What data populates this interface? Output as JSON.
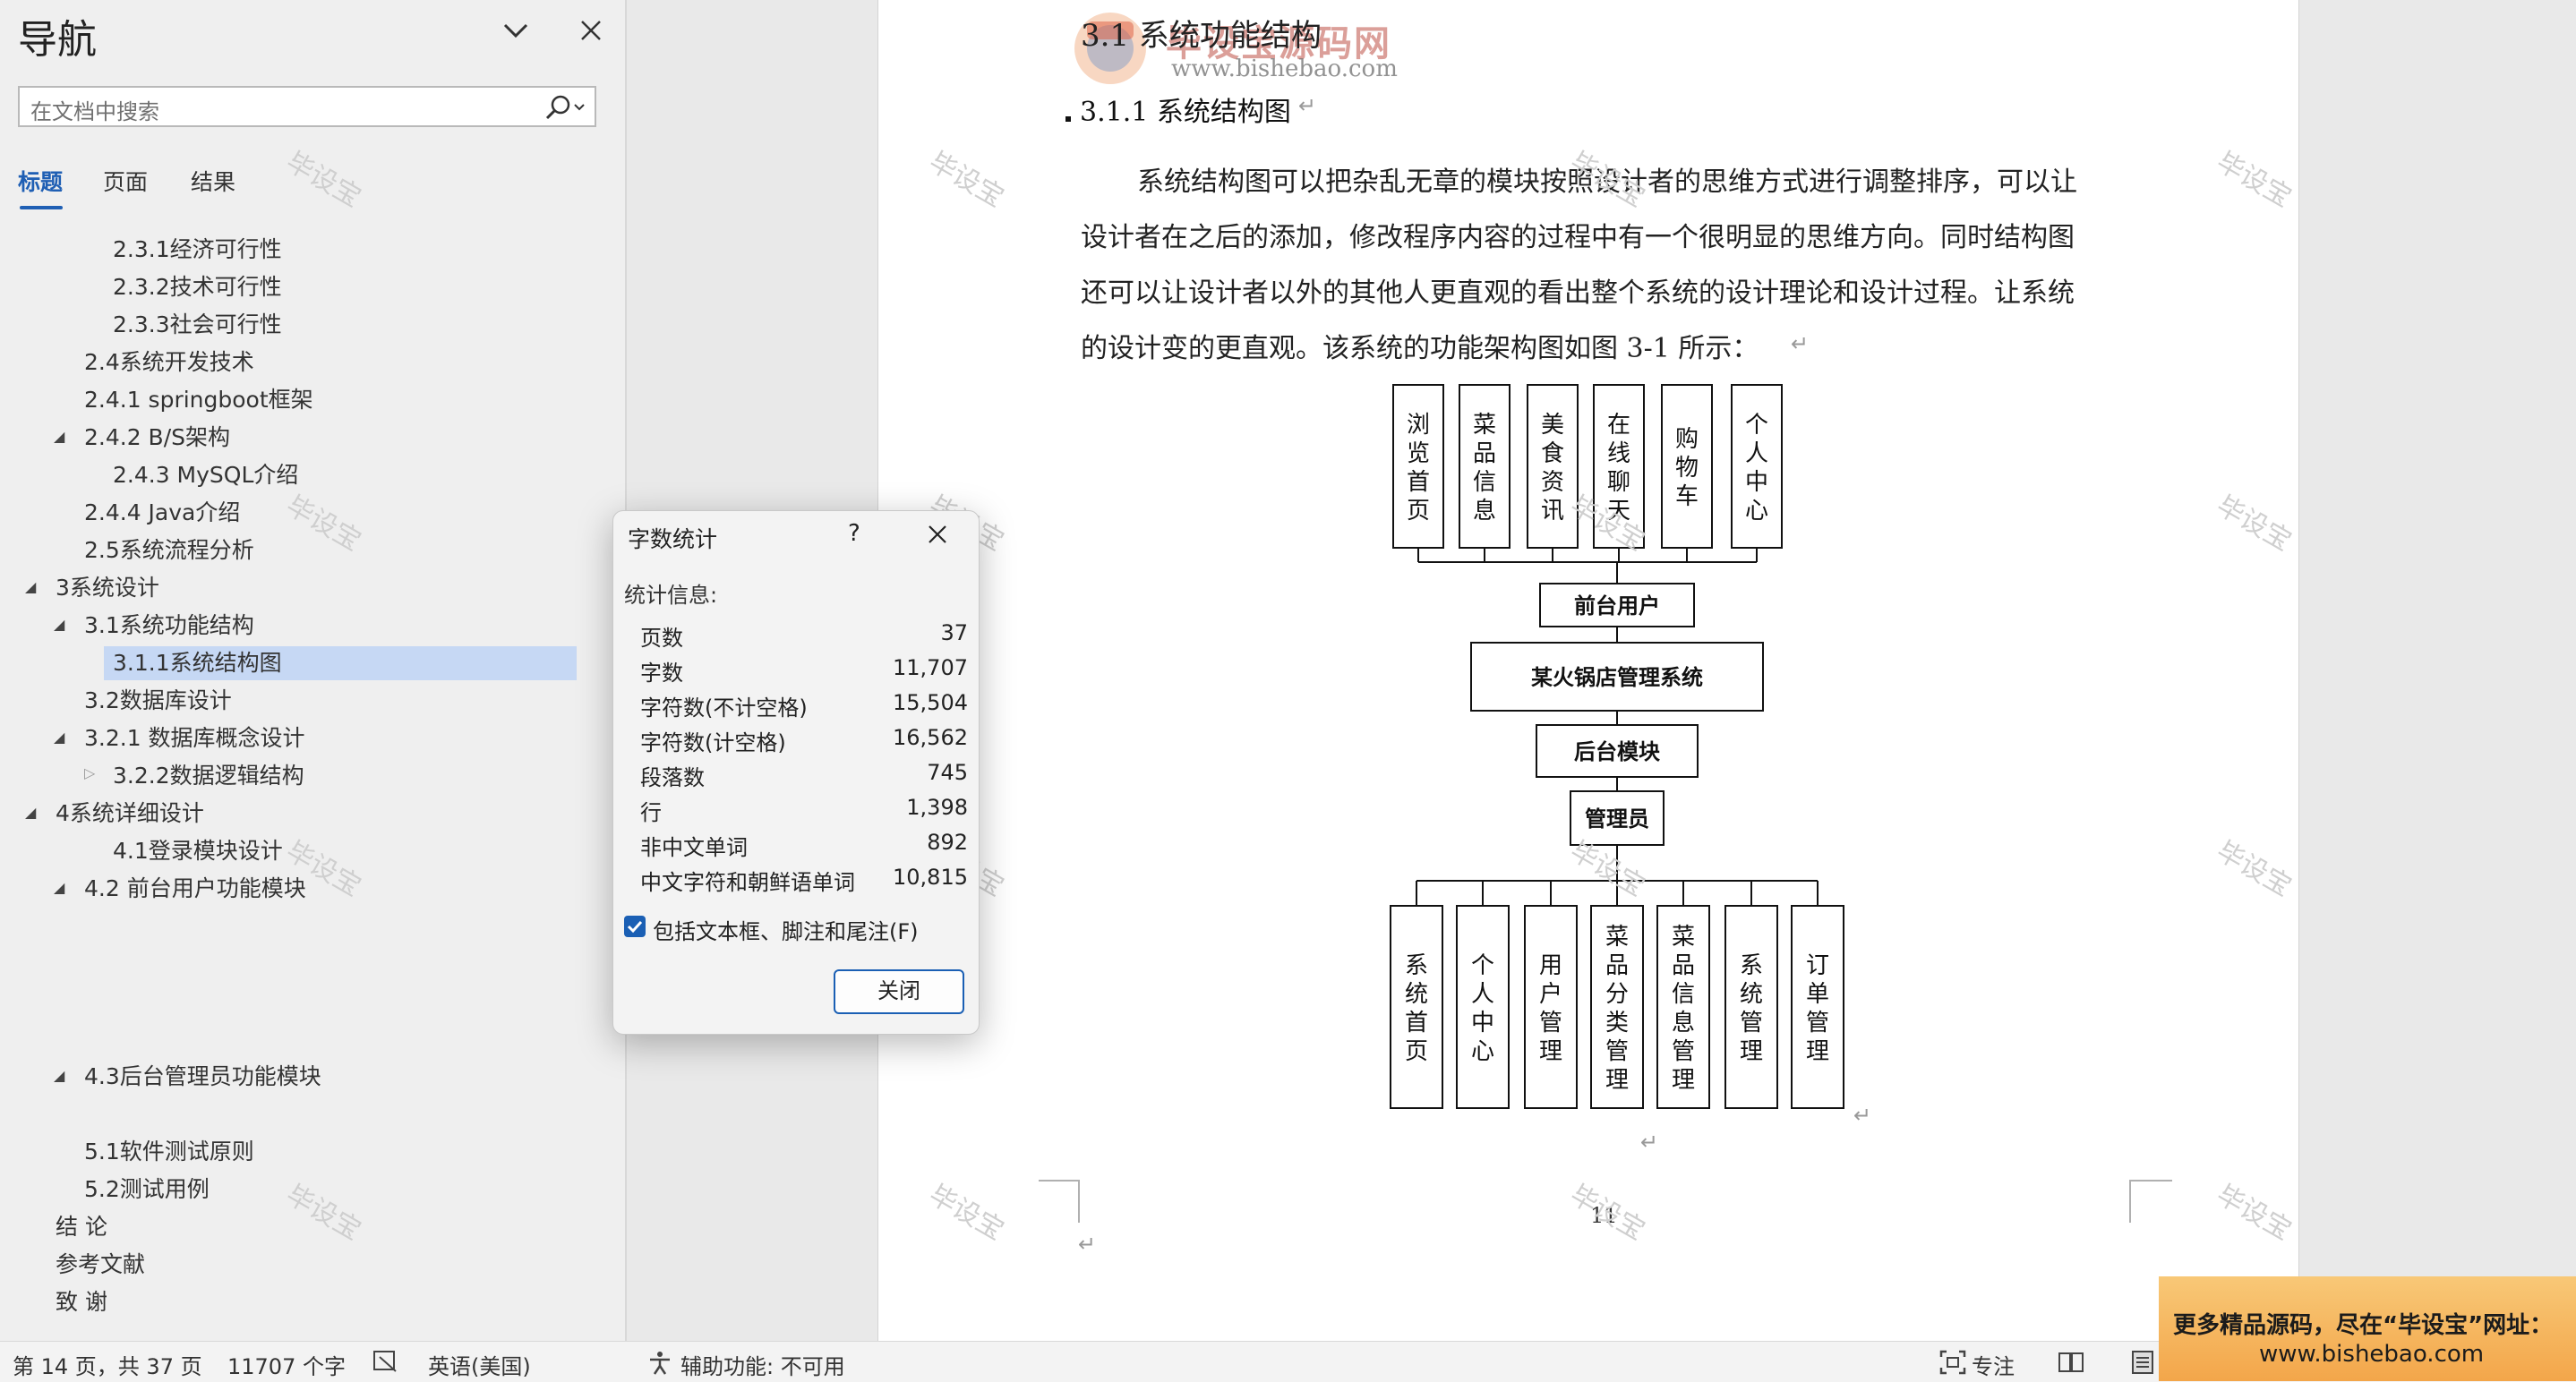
{
  "nav": {
    "title": "导航",
    "search_placeholder": "在文档中搜索",
    "tabs": [
      "标题",
      "页面",
      "结果"
    ],
    "items": [
      {
        "label": "2.3.1经济可行性"
      },
      {
        "label": "2.3.2技术可行性"
      },
      {
        "label": "2.3.3社会可行性"
      },
      {
        "label": "2.4系统开发技术"
      },
      {
        "label": "2.4.1 springboot框架"
      },
      {
        "label": "2.4.2 B/S架构"
      },
      {
        "label": "2.4.3 MySQL介绍"
      },
      {
        "label": "2.4.4 Java介绍"
      },
      {
        "label": "2.5系统流程分析"
      },
      {
        "label": "3系统设计"
      },
      {
        "label": "3.1系统功能结构"
      },
      {
        "label": "3.1.1系统结构图"
      },
      {
        "label": "3.2数据库设计"
      },
      {
        "label": "3.2.1 数据库概念设计"
      },
      {
        "label": "3.2.2数据逻辑结构"
      },
      {
        "label": "4系统详细设计"
      },
      {
        "label": "4.1登录模块设计"
      },
      {
        "label": "4.2 前台用户功能模块"
      },
      {
        "label": "4.3后台管理员功能模块"
      },
      {
        "label": "5.1软件测试原则"
      },
      {
        "label": "5.2测试用例"
      },
      {
        "label": "结 论"
      },
      {
        "label": "参考文献"
      },
      {
        "label": "致 谢"
      }
    ]
  },
  "document": {
    "section_heading": "3.1 系统功能结构",
    "subsection_heading": "3.1.1 系统结构图",
    "paragraph_lines": [
      "系统结构图可以把杂乱无章的模块按照设计者的思维方式进行调整排序，可以让",
      "设计者在之后的添加，修改程序内容的过程中有一个很明显的思维方向。同时结构图",
      "还可以让设计者以外的其他人更直观的看出整个系统的设计理论和设计过程。让系统",
      "的设计变的更直观。该系统的功能架构图如图 3-1 所示："
    ],
    "page_number": "11",
    "watermark": "毕设宝",
    "logo_text": "毕设宝源码网",
    "logo_url": "www.bishebao.com"
  },
  "diagram": {
    "front_modules": [
      "浏览首页",
      "菜品信息",
      "美食资讯",
      "在线聊天",
      "购物车",
      "个人中心"
    ],
    "front_user": "前台用户",
    "system": "某火锅店管理系统",
    "backend": "后台模块",
    "admin": "管理员",
    "admin_modules": [
      "系统首页",
      "个人中心",
      "用户管理",
      "菜品分类管理",
      "菜品信息管理",
      "系统管理",
      "订单管理"
    ]
  },
  "dialog": {
    "title": "字数统计",
    "help": "?",
    "stats_label": "统计信息:",
    "stats": [
      {
        "label": "页数",
        "value": "37"
      },
      {
        "label": "字数",
        "value": "11,707"
      },
      {
        "label": "字符数(不计空格)",
        "value": "15,504"
      },
      {
        "label": "字符数(计空格)",
        "value": "16,562"
      },
      {
        "label": "段落数",
        "value": "745"
      },
      {
        "label": "行",
        "value": "1,398"
      },
      {
        "label": "非中文单词",
        "value": "892"
      },
      {
        "label": "中文字符和朝鲜语单词",
        "value": "10,815"
      }
    ],
    "checkbox_label": "包括文本框、脚注和尾注(F)",
    "checkbox_checked": true,
    "close_label": "关闭"
  },
  "statusbar": {
    "page_info": "第 14 页，共 37 页",
    "word_count": "11707 个字",
    "language": "英语(美国)",
    "accessibility": "辅助功能: 不可用",
    "focus": "专注"
  },
  "promo": {
    "line1": "更多精品源码，尽在“毕设宝”网址：",
    "line2": "www.bishebao.com"
  }
}
